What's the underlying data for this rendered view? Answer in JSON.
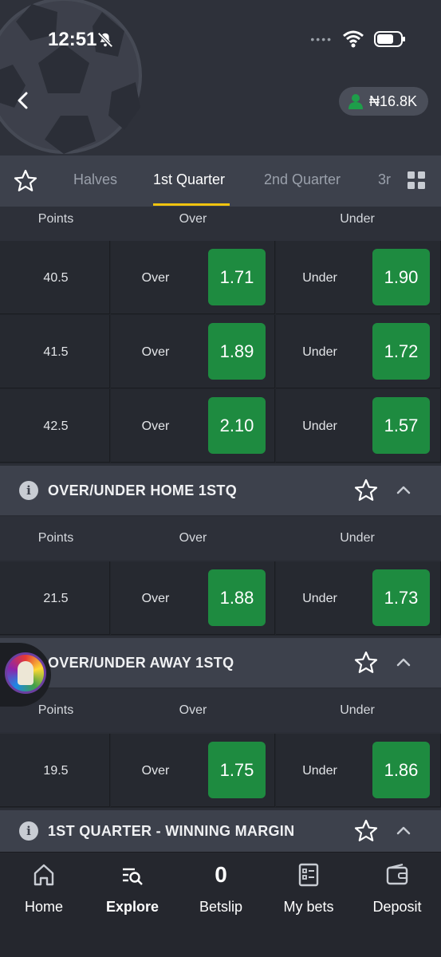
{
  "status": {
    "time": "12:51",
    "signal_dots": "••••"
  },
  "header": {
    "balance": "₦16.8K"
  },
  "tabs": [
    "Halves",
    "1st Quarter",
    "2nd Quarter",
    "3r"
  ],
  "market1": {
    "columns": [
      "Points",
      "Over",
      "Under"
    ],
    "rows": [
      {
        "points": "40.5",
        "over_label": "Over",
        "over_odd": "1.71",
        "under_label": "Under",
        "under_odd": "1.90"
      },
      {
        "points": "41.5",
        "over_label": "Over",
        "over_odd": "1.89",
        "under_label": "Under",
        "under_odd": "1.72"
      },
      {
        "points": "42.5",
        "over_label": "Over",
        "over_odd": "2.10",
        "under_label": "Under",
        "under_odd": "1.57"
      }
    ]
  },
  "market2": {
    "title": "OVER/UNDER HOME 1STQ",
    "columns": [
      "Points",
      "Over",
      "Under"
    ],
    "rows": [
      {
        "points": "21.5",
        "over_label": "Over",
        "over_odd": "1.88",
        "under_label": "Under",
        "under_odd": "1.73"
      }
    ]
  },
  "market3": {
    "title": "OVER/UNDER AWAY 1STQ",
    "columns": [
      "Points",
      "Over",
      "Under"
    ],
    "rows": [
      {
        "points": "19.5",
        "over_label": "Over",
        "over_odd": "1.75",
        "under_label": "Under",
        "under_odd": "1.86"
      }
    ]
  },
  "market4": {
    "title": "1ST QUARTER - WINNING MARGIN"
  },
  "nav": {
    "home": "Home",
    "explore": "Explore",
    "betslip_count": "0",
    "betslip": "Betslip",
    "mybets": "My bets",
    "deposit": "Deposit"
  },
  "colors": {
    "odds_green": "#1e8b40",
    "tab_underline": "#f1c40f",
    "background": "#2b2e36"
  }
}
